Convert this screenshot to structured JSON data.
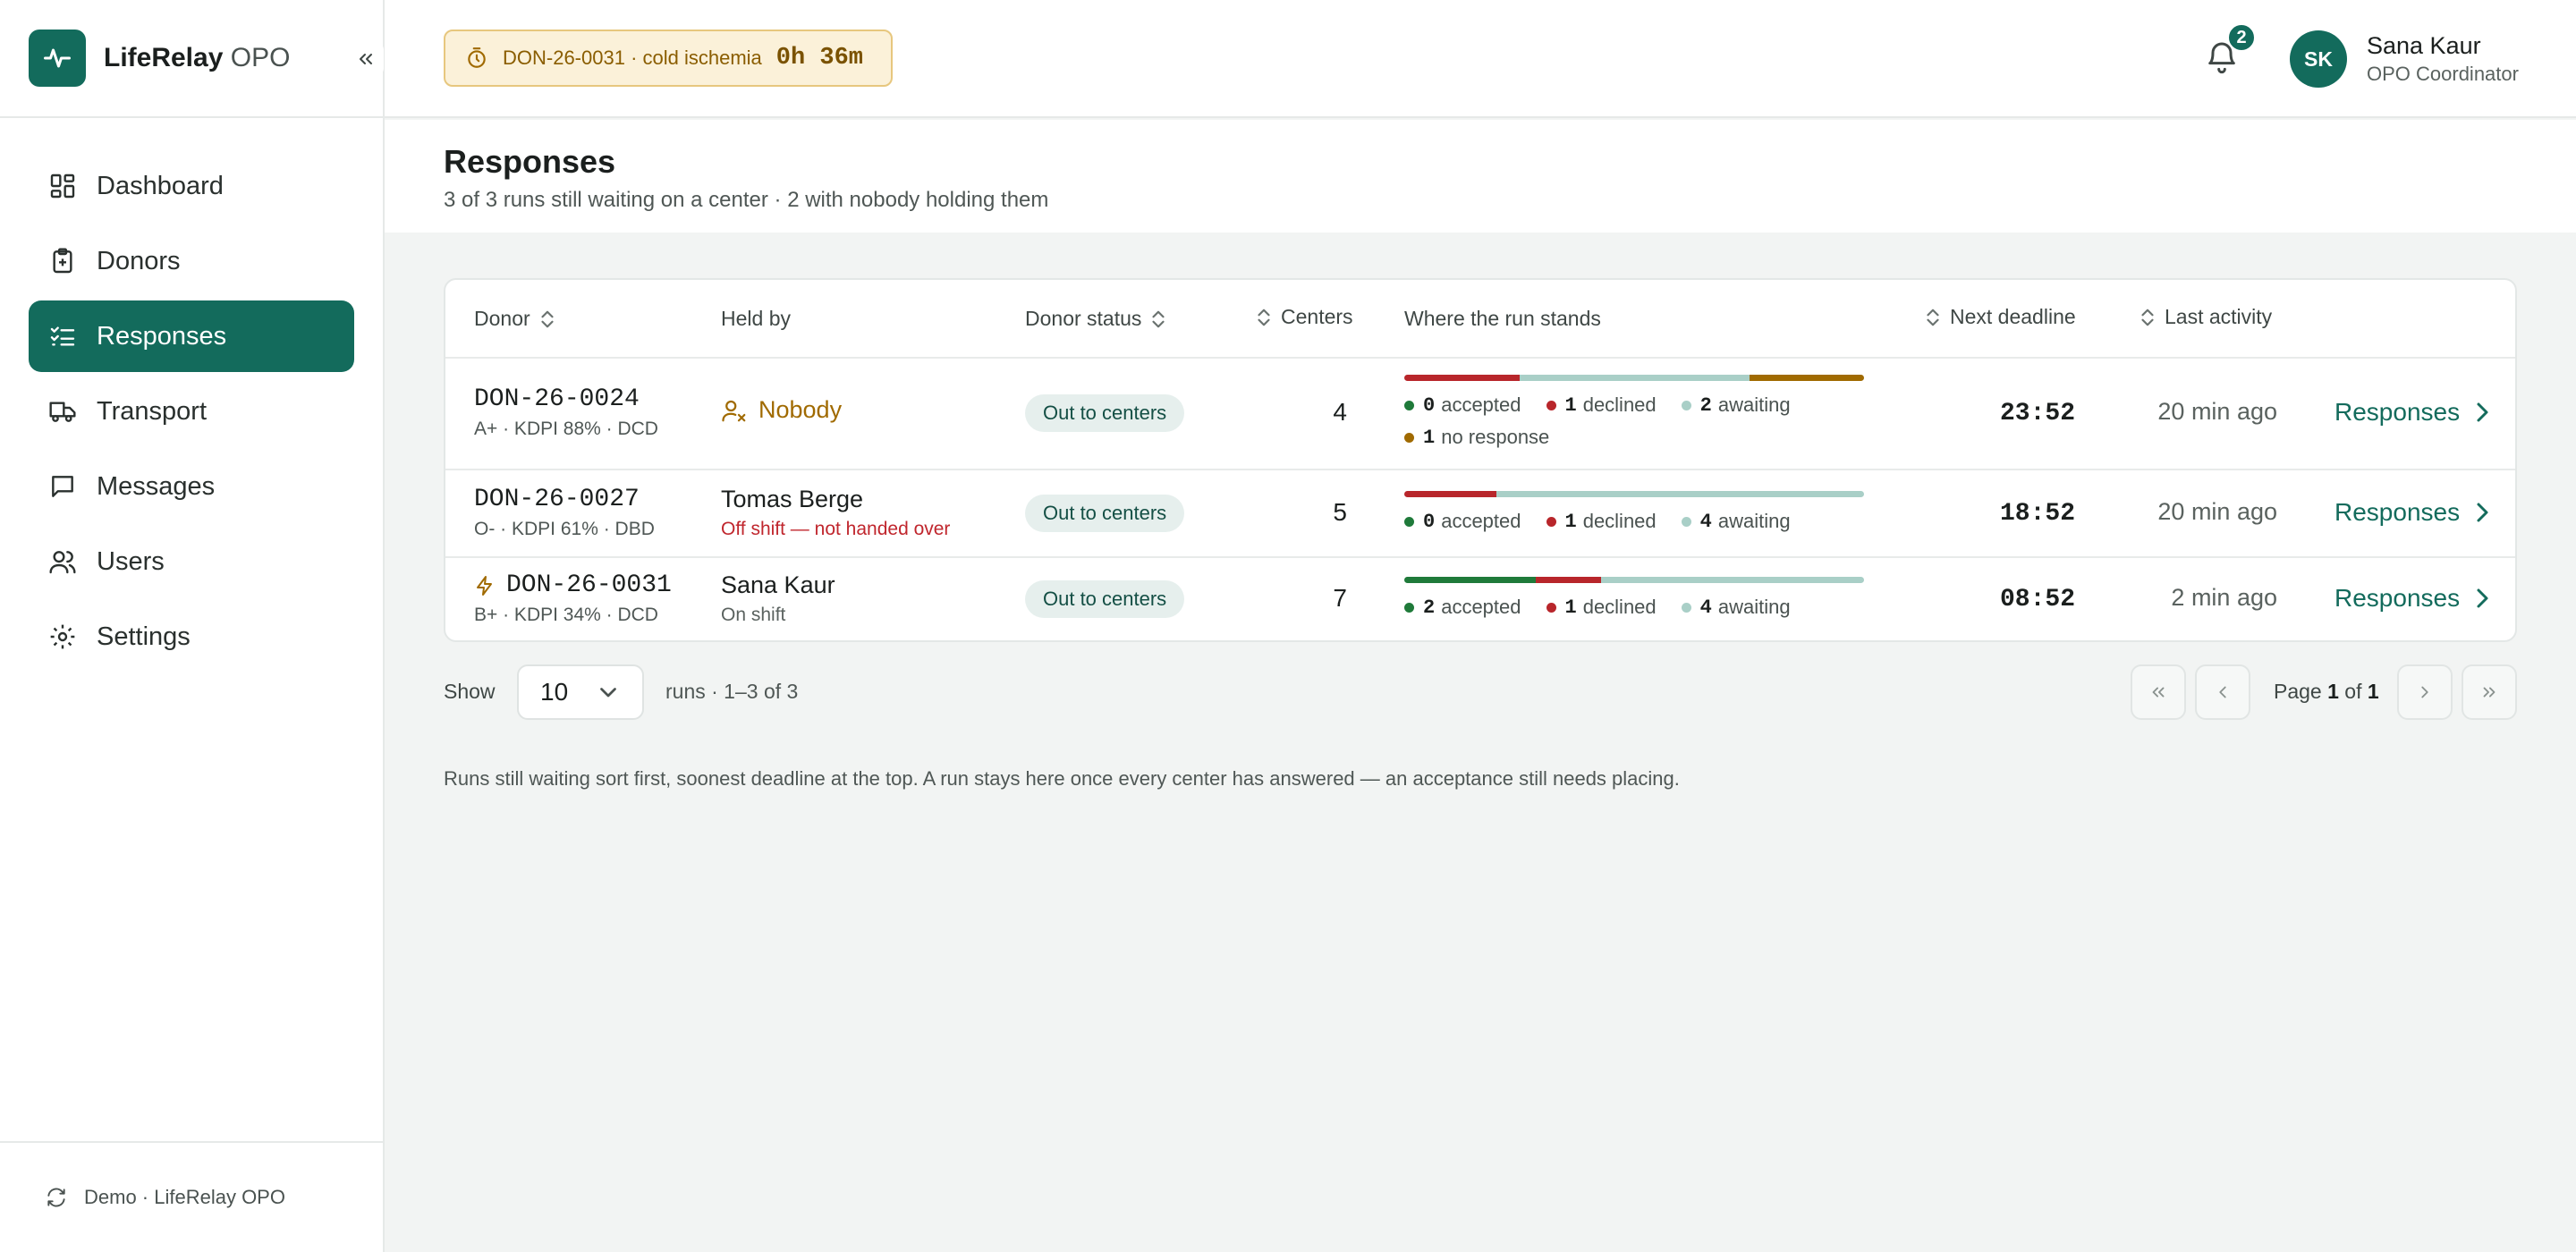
{
  "brand": {
    "name": "LifeRelay",
    "suffix": "OPO"
  },
  "nav": [
    {
      "label": "Dashboard",
      "icon": "dashboard-icon"
    },
    {
      "label": "Donors",
      "icon": "clipboard-icon"
    },
    {
      "label": "Responses",
      "icon": "list-check-icon",
      "active": true
    },
    {
      "label": "Transport",
      "icon": "truck-icon"
    },
    {
      "label": "Messages",
      "icon": "message-icon"
    },
    {
      "label": "Users",
      "icon": "users-icon"
    },
    {
      "label": "Settings",
      "icon": "gear-icon"
    }
  ],
  "sidebar_footer": "Demo · LifeRelay OPO",
  "topbar": {
    "timer_label": "DON-26-0031 · cold ischemia",
    "timer_value": "0h 36m",
    "notifications": "2",
    "user_initials": "SK",
    "user_name": "Sana Kaur",
    "user_role": "OPO Coordinator"
  },
  "page": {
    "title": "Responses",
    "subtitle": "3 of 3 runs still waiting on a center · 2 with nobody holding them"
  },
  "table": {
    "headers": {
      "donor": "Donor",
      "held_by": "Held by",
      "status": "Donor status",
      "centers": "Centers",
      "stands": "Where the run stands",
      "deadline": "Next deadline",
      "activity": "Last activity"
    },
    "rows": [
      {
        "donor_id": "DON-26-0024",
        "donor_meta": "A+ · KDPI 88% · DCD",
        "held_by": "Nobody",
        "held_sub": "",
        "status": "Out to centers",
        "centers": "4",
        "accepted": "0",
        "declined": "1",
        "awaiting": "2",
        "no_response": "1",
        "accepted_label": "accepted",
        "declined_label": "declined",
        "awaiting_label": "awaiting",
        "no_response_label": "no response",
        "deadline": "23:52",
        "activity": "20 min ago",
        "link": "Responses"
      },
      {
        "donor_id": "DON-26-0027",
        "donor_meta": "O- · KDPI 61% · DBD",
        "held_by": "Tomas Berge",
        "held_sub": "Off shift — not handed over",
        "status": "Out to centers",
        "centers": "5",
        "accepted": "0",
        "declined": "1",
        "awaiting": "4",
        "accepted_label": "accepted",
        "declined_label": "declined",
        "awaiting_label": "awaiting",
        "deadline": "18:52",
        "activity": "20 min ago",
        "link": "Responses"
      },
      {
        "donor_id": "DON-26-0031",
        "donor_meta": "B+ · KDPI 34% · DCD",
        "held_by": "Sana Kaur",
        "held_sub": "On shift",
        "status": "Out to centers",
        "centers": "7",
        "accepted": "2",
        "declined": "1",
        "awaiting": "4",
        "accepted_label": "accepted",
        "declined_label": "declined",
        "awaiting_label": "awaiting",
        "deadline": "08:52",
        "activity": "2 min ago",
        "link": "Responses"
      }
    ]
  },
  "pagination": {
    "show_label": "Show",
    "page_size": "10",
    "runs_label": "runs · 1–3 of 3",
    "page_prefix": "Page",
    "page_current": "1",
    "page_of": "of",
    "page_total": "1"
  },
  "footnote": "Runs still waiting sort first, soonest deadline at the top. A run stays here once every center has answered — an acceptance still needs placing.",
  "colors": {
    "accent": "#136b5c",
    "accepted": "#1f7a3a",
    "declined": "#b8262b",
    "awaiting": "#a9cfc7",
    "no_response": "#a06a00"
  }
}
